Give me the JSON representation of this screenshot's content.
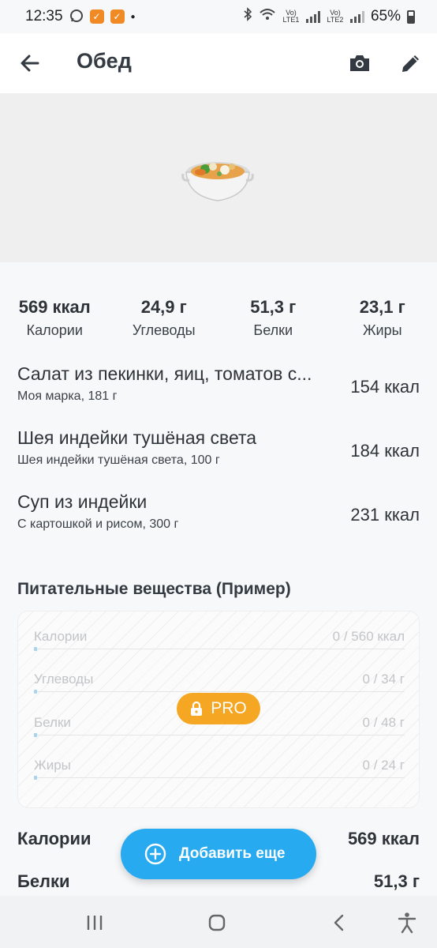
{
  "status": {
    "time": "12:35",
    "sim1": "Vo) LTE1",
    "sim2": "Vo) LTE2",
    "battery": "65%"
  },
  "header": {
    "title": "Обед"
  },
  "macros": [
    {
      "value": "569 ккал",
      "label": "Калории"
    },
    {
      "value": "24,9 г",
      "label": "Углеводы"
    },
    {
      "value": "51,3 г",
      "label": "Белки"
    },
    {
      "value": "23,1 г",
      "label": "Жиры"
    }
  ],
  "foods": [
    {
      "name": "Салат из пекинки, яиц, томатов с...",
      "desc": "Моя марка, 181 г",
      "kcal": "154 ккал"
    },
    {
      "name": "Шея индейки тушёная света",
      "desc": "Шея индейки тушёная света, 100 г",
      "kcal": "184 ккал"
    },
    {
      "name": "Суп из индейки",
      "desc": "С картошкой и рисом, 300 г",
      "kcal": "231 ккал"
    }
  ],
  "nutrients": {
    "title": "Питательные вещества (Пример)",
    "rows": [
      {
        "label": "Калории",
        "value": "0 / 560 ккал",
        "progress": 0
      },
      {
        "label": "Углеводы",
        "value": "0 / 34 г",
        "progress": 0
      },
      {
        "label": "Белки",
        "value": "0 / 48 г",
        "progress": 0
      },
      {
        "label": "Жиры",
        "value": "0 / 24 г",
        "progress": 0
      }
    ],
    "pro_label": "PRO"
  },
  "summary": [
    {
      "label": "Калории",
      "value": "569 ккал"
    },
    {
      "label": "Белки",
      "value": "51,3 г"
    }
  ],
  "add_button": {
    "label": "Добавить еще"
  },
  "colors": {
    "accent": "#27aaf0",
    "pro": "#f5a623",
    "hero_bg": "#efeff0"
  }
}
